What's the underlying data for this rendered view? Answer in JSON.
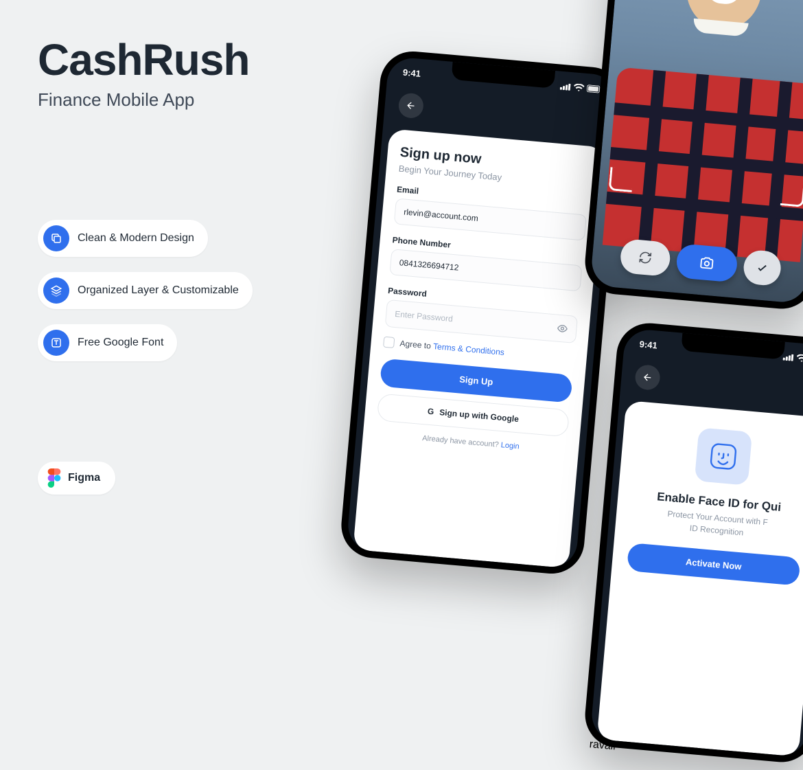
{
  "hero": {
    "title": "CashRush",
    "subtitle": "Finance Mobile App"
  },
  "features": [
    {
      "icon": "layers",
      "label": "Clean & Modern Design"
    },
    {
      "icon": "stack",
      "label": "Organized Layer & Customizable"
    },
    {
      "icon": "type",
      "label": "Free Google Font"
    }
  ],
  "tool": {
    "name": "Figma"
  },
  "colors": {
    "accent": "#2f6fed",
    "dark": "#141c27",
    "text": "#1e2833",
    "muted": "#8b95a3",
    "bg": "#eff1f2"
  },
  "phone1": {
    "time": "9:41",
    "signup": {
      "title": "Sign up now",
      "subtitle": "Begin Your Journey Today",
      "fields": {
        "email": {
          "label": "Email",
          "value": "rlevin@account.com"
        },
        "phone": {
          "label": "Phone Number",
          "value": "0841326694712"
        },
        "password": {
          "label": "Password",
          "placeholder": "Enter Password"
        }
      },
      "agree_prefix": "Agree to ",
      "terms_link": "Terms & Conditions",
      "submit": "Sign Up",
      "google": "Sign up with Google",
      "footer_text": "Already have account? ",
      "footer_link": "Login"
    }
  },
  "phone2": {
    "controls": {
      "flip": "refresh-icon",
      "capture": "camera-icon",
      "confirm": "check-icon"
    }
  },
  "phone3": {
    "time": "9:41",
    "faceid": {
      "title": "Enable Face ID for Qui",
      "subtitle_line1": "Protect Your Account with F",
      "subtitle_line2": "ID Recognition",
      "activate": "Activate Now"
    }
  }
}
